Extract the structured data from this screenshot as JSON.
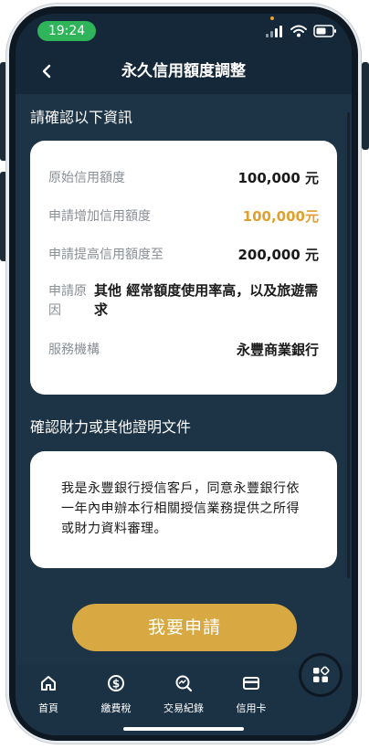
{
  "status": {
    "time": "19:24"
  },
  "header": {
    "title": "永久信用額度調整"
  },
  "confirm_section": {
    "title": "請確認以下資訊"
  },
  "details": [
    {
      "label": "原始信用額度",
      "value": "100,000 元",
      "color": "#1a1a1a"
    },
    {
      "label": "申請增加信用額度",
      "value": "100,000元",
      "color": "#e0a030"
    },
    {
      "label": "申請提高信用額度至",
      "value": "200,000 元",
      "color": "#1a1a1a"
    },
    {
      "label_line1": "申請原",
      "label_line2": "因",
      "value": "其他  經常額度使用率高，以及旅遊需求"
    },
    {
      "label": "服務機構",
      "value": "永豐商業銀行",
      "color": "#1a1a1a"
    }
  ],
  "docs_section": {
    "title": "確認財力或其他證明文件",
    "statement": "我是永豐銀行授信客戶，同意永豐銀行依一年內申辦本行相關授信業務提供之所得或財力資料審理。"
  },
  "apply_button": {
    "label": "我要申請"
  },
  "tabs": [
    {
      "label": "首頁",
      "icon": "home-icon"
    },
    {
      "label": "繳費稅",
      "icon": "dollar-icon"
    },
    {
      "label": "交易紀錄",
      "icon": "search-chart-icon"
    },
    {
      "label": "信用卡",
      "icon": "credit-card-icon"
    }
  ],
  "colors": {
    "accent": "#d8a842",
    "background": "#1d3346",
    "highlight": "#e0a030"
  }
}
